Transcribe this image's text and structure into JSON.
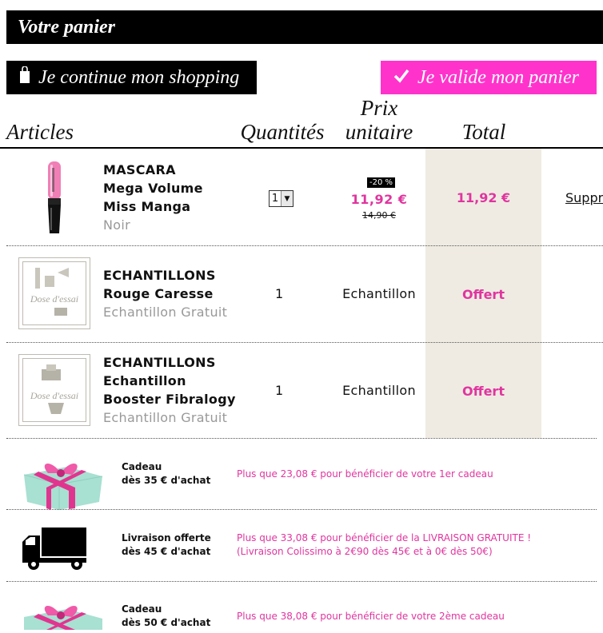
{
  "header": {
    "title": "Votre panier"
  },
  "actions": {
    "continue_label": "Je continue mon shopping",
    "validate_label": "Je valide mon panier"
  },
  "columns": {
    "articles": "Articles",
    "quantities": "Quantités",
    "unit_price_line1": "Prix",
    "unit_price_line2": "unitaire",
    "total": "Total"
  },
  "items": [
    {
      "line1": "MASCARA",
      "line2": "Mega Volume",
      "line3": "Miss Manga",
      "variant": "Noir",
      "quantity": "1",
      "discount_badge": "-20 %",
      "unit_price": "11,92 €",
      "old_price": "14,90 €",
      "total": "11,92 €",
      "remove_label": "Supprimer"
    },
    {
      "line1": "ECHANTILLONS",
      "line2": "Rouge Caresse",
      "variant": "Echantillon Gratuit",
      "quantity": "1",
      "unit_price": "Echantillon",
      "total": "Offert",
      "image_label": "Dose d'essai"
    },
    {
      "line1": "ECHANTILLONS",
      "line2": "Echantillon",
      "line3": "Booster Fibralogy",
      "variant": "Echantillon Gratuit",
      "quantity": "1",
      "unit_price": "Echantillon",
      "total": "Offert",
      "image_label": "Dose d'essai"
    }
  ],
  "promos": [
    {
      "line1": "Cadeau",
      "line2": "dès 35 € d'achat",
      "msg1": "Plus que 23,08 € pour bénéficier de votre 1er cadeau",
      "icon": "gift-icon"
    },
    {
      "line1": "Livraison offerte",
      "line2": "dès 45 € d'achat",
      "msg1": "Plus que 33,08 € pour bénéficier de la LIVRAISON GRATUITE !",
      "msg2": "(Livraison Colissimo à 2€90 dès 45€ et à 0€ dès 50€)",
      "icon": "truck-icon"
    },
    {
      "line1": "Cadeau",
      "line2": "dès 50 € d'achat",
      "msg1": "Plus que 38,08 € pour bénéficier de votre 2ème cadeau",
      "icon": "gift-icon"
    }
  ],
  "colors": {
    "accent": "#ff33cc",
    "price": "#e0359f",
    "total_bg": "#efebe3"
  }
}
